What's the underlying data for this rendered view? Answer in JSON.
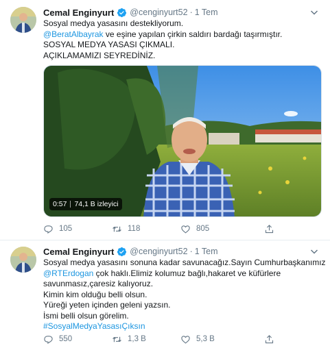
{
  "colors": {
    "link": "#1b95e0",
    "secondary_text": "#657786",
    "verified": "#1da1f2",
    "divider": "#e6ecf0"
  },
  "tweets": [
    {
      "author_name": "Cemal Enginyurt",
      "verified_icon": "verified-badge-icon",
      "handle": "@cenginyurt52",
      "separator": "·",
      "time": "1 Tem",
      "lines": [
        {
          "text": "Sosyal medya yasasını destekliyorum."
        },
        {
          "mention": "@BeratAlbayrak",
          "text": " ve eşine yapılan çirkin saldırı bardağı taşırmıştır."
        },
        {
          "text": "SOSYAL MEDYA YASASI ÇIKMALI."
        },
        {
          "text": "AÇIKLAMAMIZI SEYREDİNİZ."
        }
      ],
      "video": {
        "duration": "0:57",
        "views": "74,1 B izleyici"
      },
      "actions": {
        "replies": "105",
        "retweets": "118",
        "likes": "805"
      }
    },
    {
      "author_name": "Cemal Enginyurt",
      "verified_icon": "verified-badge-icon",
      "handle": "@cenginyurt52",
      "separator": "·",
      "time": "1 Tem",
      "lines": [
        {
          "text": "Sosyal medya yasasını sonuna kadar savunacağız.Sayın Cumhurbaşkanımız"
        },
        {
          "mention": "@RTErdogan",
          "text": " çok haklı.Elimiz kolumuz bağlı,hakaret ve küfürlere"
        },
        {
          "text": "savunmasız,çaresiz kalıyoruz."
        },
        {
          "text": "Kimin kim olduğu belli olsun."
        },
        {
          "text": "Yüreği yeten içinden geleni yazsın."
        },
        {
          "text": "İsmi belli olsun görelim."
        },
        {
          "hashtag": "#SosyalMedyaYasasıÇıksın"
        }
      ],
      "actions": {
        "replies": "550",
        "retweets": "1,3 B",
        "likes": "5,3 B"
      }
    }
  ]
}
